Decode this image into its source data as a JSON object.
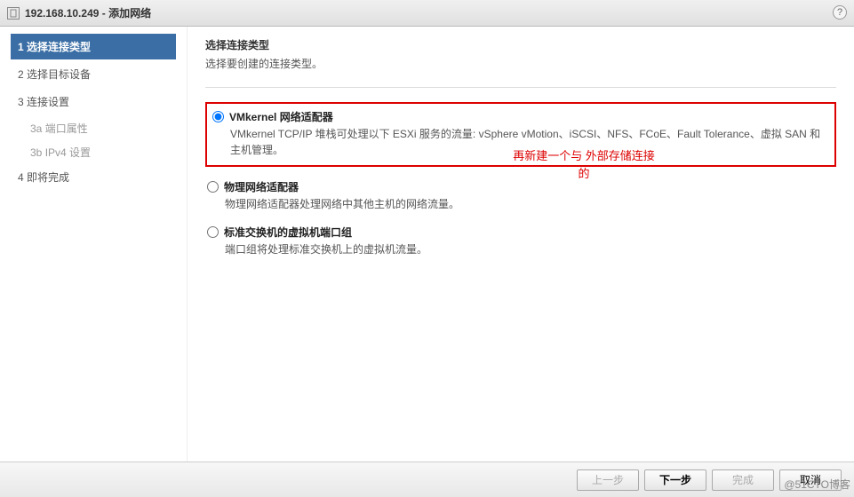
{
  "titlebar": {
    "title": "192.168.10.249 - 添加网络"
  },
  "help_tooltip": "?",
  "sidebar": {
    "steps": [
      {
        "num": "1",
        "label": "选择连接类型"
      },
      {
        "num": "2",
        "label": "选择目标设备"
      },
      {
        "num": "3",
        "label": "连接设置"
      },
      {
        "num": "4",
        "label": "即将完成"
      }
    ],
    "substeps": [
      {
        "num": "3a",
        "label": "端口属性"
      },
      {
        "num": "3b",
        "label": "IPv4 设置"
      }
    ]
  },
  "content": {
    "title": "选择连接类型",
    "subtitle": "选择要创建的连接类型。",
    "options": [
      {
        "label": "VMkernel 网络适配器",
        "desc": "VMkernel TCP/IP 堆栈可处理以下 ESXi 服务的流量: vSphere vMotion、iSCSI、NFS、FCoE、Fault Tolerance、虚拟 SAN 和主机管理。"
      },
      {
        "label": "物理网络适配器",
        "desc": "物理网络适配器处理网络中其他主机的网络流量。"
      },
      {
        "label": "标准交换机的虚拟机端口组",
        "desc": "端口组将处理标准交换机上的虚拟机流量。"
      }
    ]
  },
  "annotations": {
    "line1": "再新建一个与  外部存储连接",
    "line2": "的"
  },
  "footer": {
    "back": "上一步",
    "next": "下一步",
    "finish": "完成",
    "cancel": "取消"
  },
  "watermark": "@51CTO博客"
}
